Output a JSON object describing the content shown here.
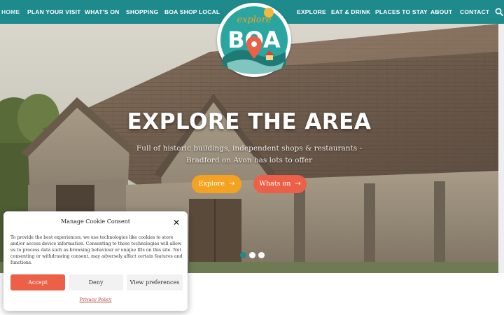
{
  "nav": {
    "left_items": [
      {
        "label": "HOME"
      },
      {
        "label": "PLAN YOUR VISIT"
      },
      {
        "label": "WHAT'S ON"
      },
      {
        "label": "SHOPPING"
      },
      {
        "label": "BOA SHOP LOCAL"
      }
    ],
    "right_items": [
      {
        "label": "EXPLORE"
      },
      {
        "label": "EAT & DRINK"
      },
      {
        "label": "PLACES TO STAY"
      },
      {
        "label": "ABOUT"
      },
      {
        "label": "CONTACT"
      }
    ],
    "search_icon": "search-icon"
  },
  "logo": {
    "word_top": "explore",
    "word_main": "BOA"
  },
  "hero": {
    "title": "EXPLORE THE AREA",
    "subtitle_line1": "Full of historic buildings, independent shops & restaurants -",
    "subtitle_line2": "Bradford on Avon has lots to offer",
    "button_explore": "Explore",
    "button_whats_on": "Whats on",
    "slides_total": 3,
    "slide_active": 1
  },
  "cookie": {
    "title": "Manage Cookie Consent",
    "text": "To provide the best experiences, we use technologies like cookies to store and/or access device information. Consenting to these technologies will allow us to process data such as browsing behaviour or unique IDs on this site. Not consenting or withdrawing consent, may adversely affect certain features and functions.",
    "accept": "Accept",
    "deny": "Deny",
    "preferences": "View preferences",
    "policy_link": "Privacy Policy"
  },
  "colors": {
    "nav_bg": "#1e8a8c",
    "accent_orange": "#f4a21f",
    "accent_red": "#ec6048"
  }
}
